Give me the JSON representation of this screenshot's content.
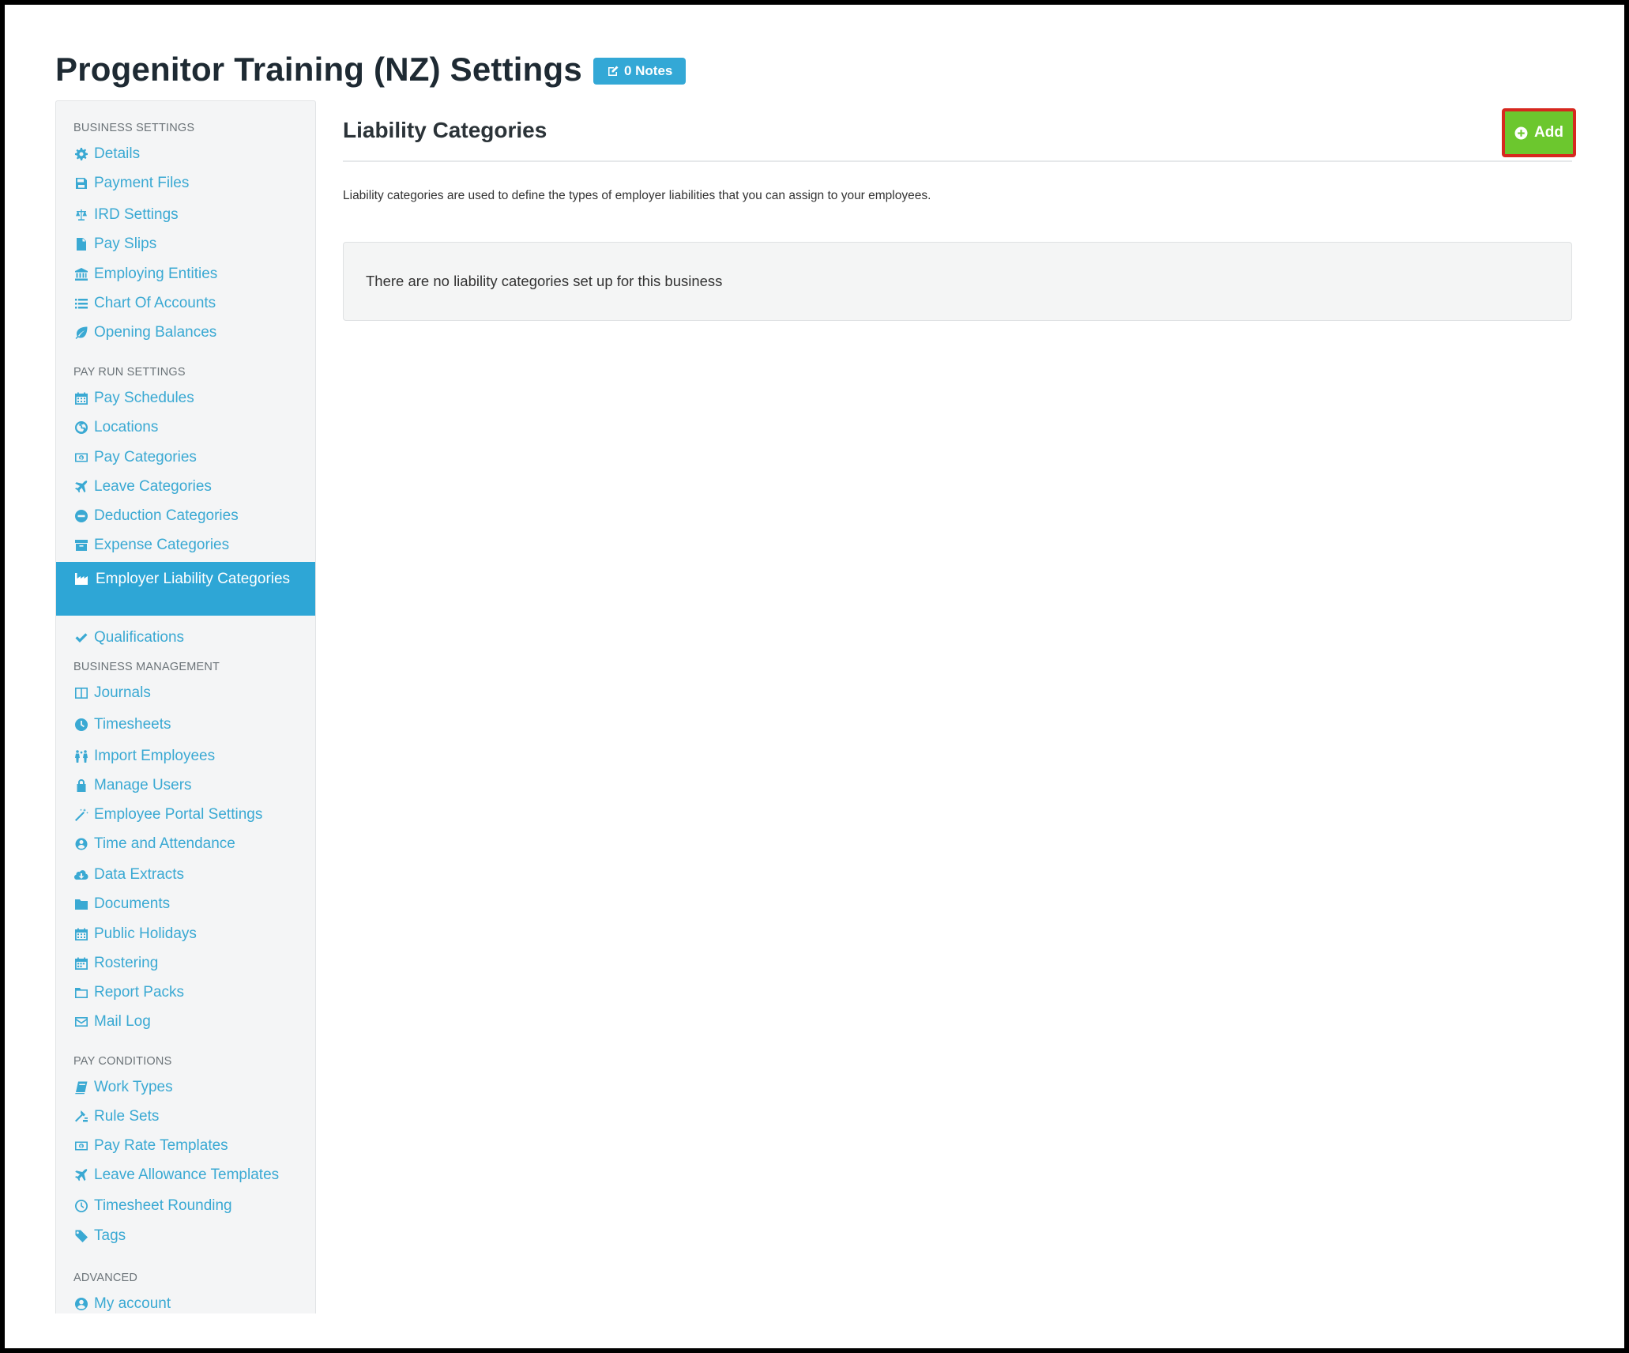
{
  "page": {
    "title": "Progenitor Training (NZ) Settings",
    "notes_label": "0 Notes"
  },
  "sidebar": {
    "sections": [
      {
        "heading": "BUSINESS SETTINGS",
        "items": [
          {
            "label": "Details",
            "icon": "gear-icon"
          },
          {
            "label": "Payment Files",
            "icon": "floppy-icon"
          },
          {
            "label": "IRD Settings",
            "icon": "scale-icon"
          },
          {
            "label": "Pay Slips",
            "icon": "file-icon"
          },
          {
            "label": "Employing Entities",
            "icon": "bank-icon"
          },
          {
            "label": "Chart Of Accounts",
            "icon": "list-icon"
          },
          {
            "label": "Opening Balances",
            "icon": "leaf-icon"
          }
        ]
      },
      {
        "heading": "PAY RUN SETTINGS",
        "items": [
          {
            "label": "Pay Schedules",
            "icon": "calendar-icon"
          },
          {
            "label": "Locations",
            "icon": "globe-icon"
          },
          {
            "label": "Pay Categories",
            "icon": "money-icon"
          },
          {
            "label": "Leave Categories",
            "icon": "plane-icon"
          },
          {
            "label": "Deduction Categories",
            "icon": "minus-circle-icon"
          },
          {
            "label": "Expense Categories",
            "icon": "archive-icon"
          },
          {
            "label": "Employer Liability Categories",
            "icon": "factory-icon",
            "active": true
          },
          {
            "label": "Qualifications",
            "icon": "check-icon"
          }
        ]
      },
      {
        "heading": "BUSINESS MANAGEMENT",
        "items": [
          {
            "label": "Journals",
            "icon": "columns-icon"
          },
          {
            "label": "Timesheets",
            "icon": "clock-icon"
          },
          {
            "label": "Import Employees",
            "icon": "people-icon"
          },
          {
            "label": "Manage Users",
            "icon": "lock-icon"
          },
          {
            "label": "Employee Portal Settings",
            "icon": "wand-icon"
          },
          {
            "label": "Time and Attendance",
            "icon": "user-clock-icon"
          },
          {
            "label": "Data Extracts",
            "icon": "cloud-download-icon"
          },
          {
            "label": "Documents",
            "icon": "folder-icon"
          },
          {
            "label": "Public Holidays",
            "icon": "calendar-icon"
          },
          {
            "label": "Rostering",
            "icon": "calendar-grid-icon"
          },
          {
            "label": "Report Packs",
            "icon": "folder-open-icon"
          },
          {
            "label": "Mail Log",
            "icon": "envelope-icon"
          }
        ]
      },
      {
        "heading": "PAY CONDITIONS",
        "items": [
          {
            "label": "Work Types",
            "icon": "book-icon"
          },
          {
            "label": "Rule Sets",
            "icon": "gavel-icon"
          },
          {
            "label": "Pay Rate Templates",
            "icon": "money-icon"
          },
          {
            "label": "Leave Allowance Templates",
            "icon": "plane-icon"
          },
          {
            "label": "Timesheet Rounding",
            "icon": "clock-outline-icon"
          },
          {
            "label": "Tags",
            "icon": "tag-icon"
          }
        ]
      },
      {
        "heading": "ADVANCED",
        "items": [
          {
            "label": "My account",
            "icon": "user-circle-icon"
          }
        ]
      }
    ]
  },
  "content": {
    "title": "Liability Categories",
    "add_label": "Add",
    "description": "Liability categories are used to define the types of employer liabilities that you can assign to your employees.",
    "empty_message": "There are no liability categories set up for this business"
  },
  "colors": {
    "accent": "#2ea6d6",
    "link": "#3aa9d3",
    "add_button": "#6cc72e",
    "highlight_border": "#d6281f"
  }
}
